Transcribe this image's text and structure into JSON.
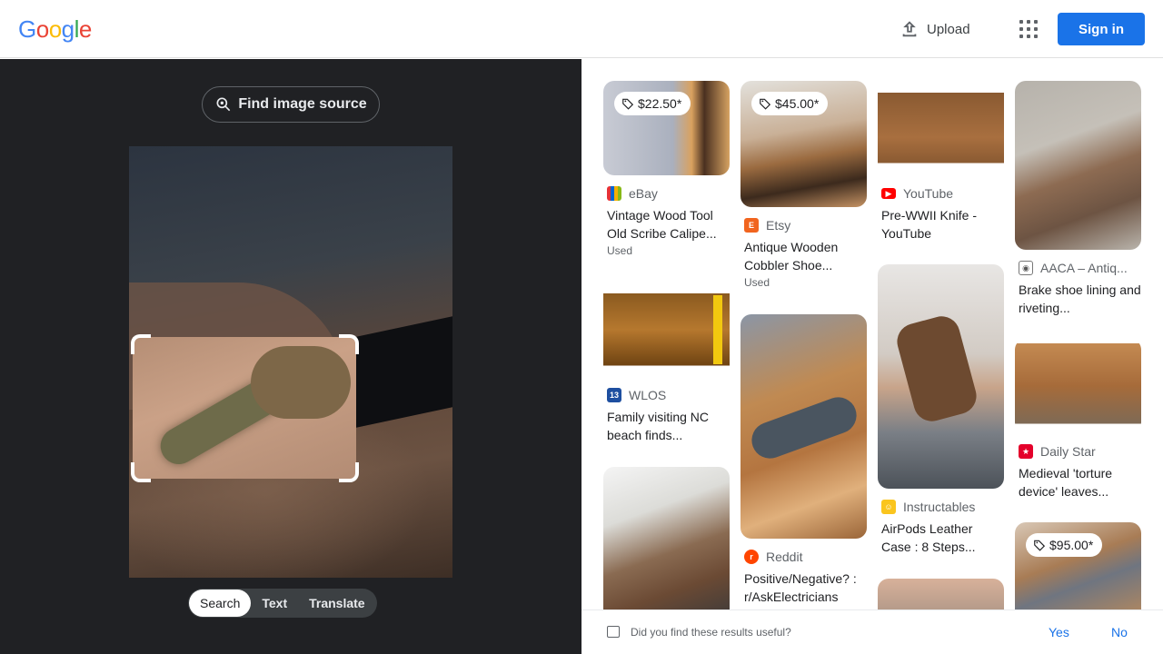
{
  "header": {
    "logo_letters": [
      {
        "ch": "G",
        "color": "#4285f4"
      },
      {
        "ch": "o",
        "color": "#ea4335"
      },
      {
        "ch": "o",
        "color": "#fbbc05"
      },
      {
        "ch": "g",
        "color": "#4285f4"
      },
      {
        "ch": "l",
        "color": "#34a853"
      },
      {
        "ch": "e",
        "color": "#ea4335"
      }
    ],
    "upload_label": "Upload",
    "signin_label": "Sign in",
    "accent_color": "#1a73e8"
  },
  "lens": {
    "find_source_label": "Find image source",
    "tabs": [
      {
        "label": "Search",
        "active": true
      },
      {
        "label": "Text",
        "active": false
      },
      {
        "label": "Translate",
        "active": false
      }
    ]
  },
  "results": [
    {
      "price": "$22.50*",
      "source": "eBay",
      "favicon": "ebay-icon",
      "title": "Vintage Wood Tool Old Scribe Calipe...",
      "meta": "Used"
    },
    {
      "price": "$45.00*",
      "source": "Etsy",
      "favicon": "etsy-icon",
      "title": "Antique Wooden Cobbler Shoe...",
      "meta": "Used"
    },
    {
      "price": "",
      "source": "YouTube",
      "favicon": "youtube-icon",
      "title": "Pre-WWII Knife - YouTube",
      "meta": ""
    },
    {
      "price": "",
      "source": "AACA – Antiq...",
      "favicon": "aaca-icon",
      "title": "Brake shoe lining and riveting...",
      "meta": ""
    },
    {
      "price": "",
      "source": "WLOS",
      "favicon": "wlos-icon",
      "title": "Family visiting NC beach finds...",
      "meta": ""
    },
    {
      "price": "",
      "source": "Reddit",
      "favicon": "reddit-icon",
      "title": "Positive/Negative? : r/AskElectricians",
      "meta": ""
    },
    {
      "price": "",
      "source": "Instructables",
      "favicon": "instructables-icon",
      "title": "AirPods Leather Case : 8 Steps...",
      "meta": ""
    },
    {
      "price": "",
      "source": "Daily Star",
      "favicon": "dailystar-icon",
      "title": "Medieval 'torture device' leaves...",
      "meta": ""
    },
    {
      "price": "",
      "source": "",
      "favicon": "",
      "title": "",
      "meta": ""
    },
    {
      "price": "",
      "source": "",
      "favicon": "",
      "title": "",
      "meta": ""
    },
    {
      "price": "$95.00*",
      "source": "",
      "favicon": "",
      "title": "",
      "meta": ""
    }
  ],
  "feedback": {
    "question": "Did you find these results useful?",
    "yes_label": "Yes",
    "no_label": "No"
  }
}
